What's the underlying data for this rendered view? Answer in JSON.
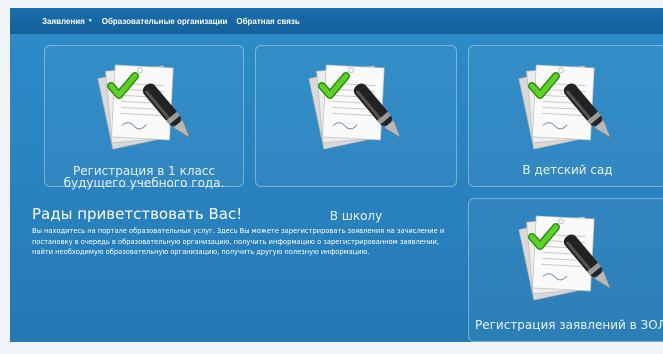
{
  "nav": {
    "items": [
      {
        "label": "Заявления",
        "has_dropdown": true
      },
      {
        "label": "Образовательные организации",
        "has_dropdown": false
      },
      {
        "label": "Обратная связь",
        "has_dropdown": false
      }
    ]
  },
  "tiles": [
    {
      "label_line1": "Регистрация в 1 класс",
      "label_line2": "будущего учебного года.",
      "icon": "document-signing-icon"
    },
    {
      "label": "В школу",
      "icon": "document-signing-icon"
    },
    {
      "label": "В детский сад",
      "icon": "document-signing-icon"
    },
    {
      "label": "Регистрация заявлений в ЗОЛ",
      "icon": "document-signing-icon"
    }
  ],
  "welcome": {
    "title": "Рады приветствовать Вас!",
    "text": "Вы находитесь на портале образовательных услуг. Здесь Вы можете зарегистрировать заявления на зачисление и постановку в очередь в образовательную организацию, получить информацию о зарегистрированном заявлении, найти необходимую образовательную организацию, получить другую полезную информацию."
  },
  "colors": {
    "background": "#2a84c0",
    "navbar": "#1a6fae",
    "check": "#4fc21a"
  }
}
